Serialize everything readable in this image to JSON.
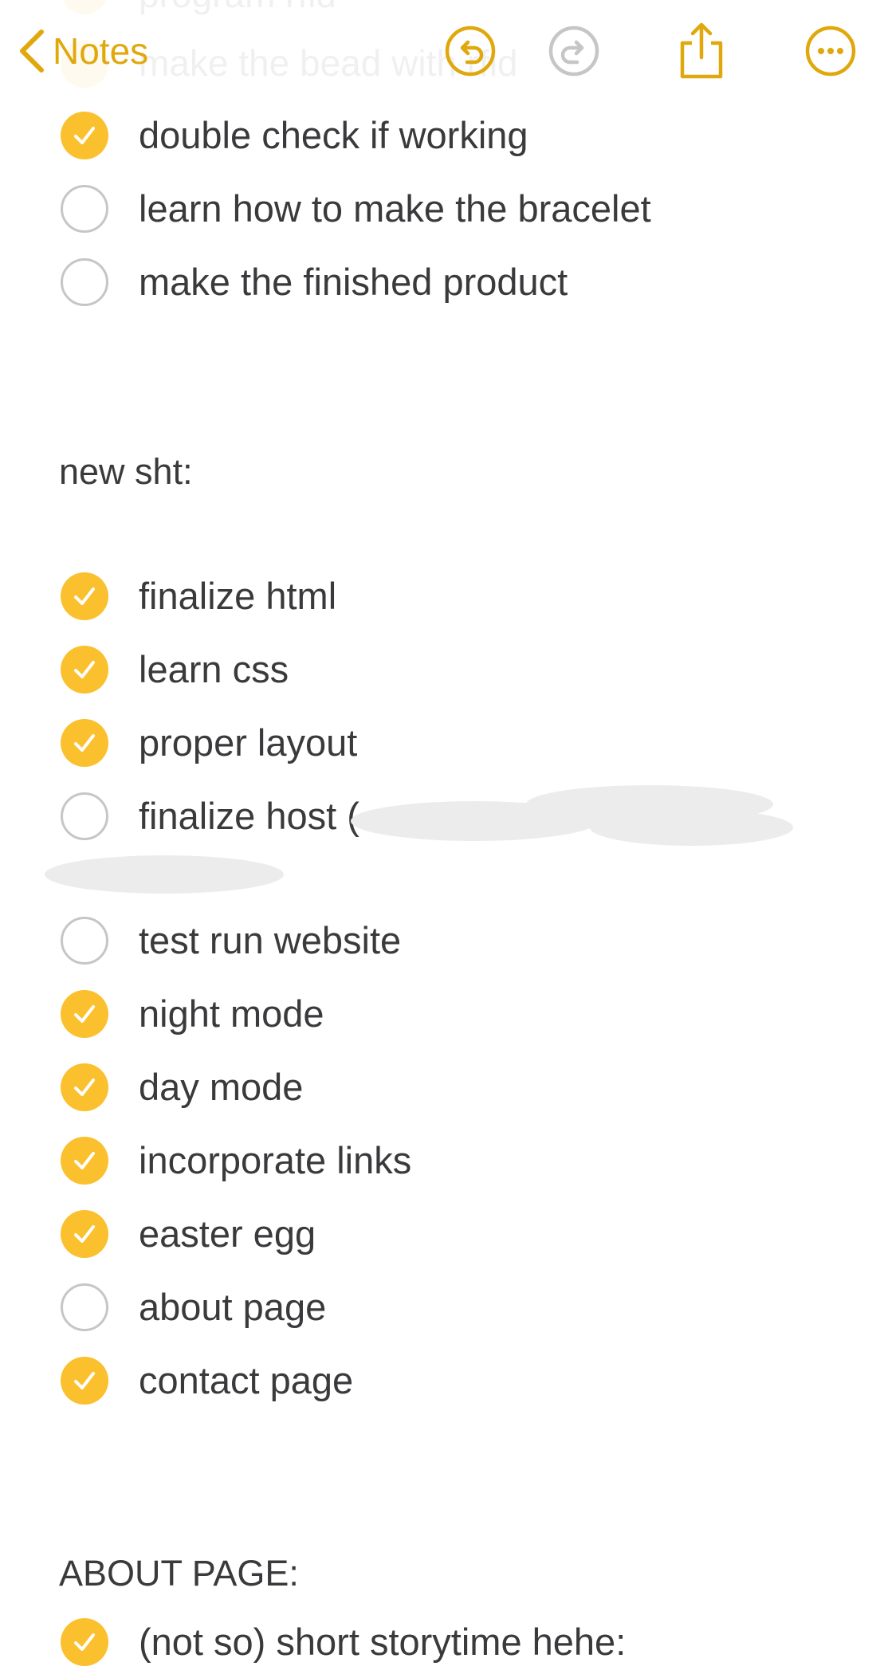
{
  "nav": {
    "back_label": "Notes",
    "icons": {
      "back": "chevron-left-icon",
      "undo": "undo-icon",
      "redo": "redo-icon",
      "share": "share-icon",
      "more": "more-icon"
    }
  },
  "colors": {
    "accent": "#e0a80d",
    "check_fill": "#fbc02d",
    "text": "#3a3a3c",
    "unchecked_border": "#c6c6c8"
  },
  "partial_top": {
    "line1": "program rfid",
    "line2": "make the bead with rfid"
  },
  "list1": [
    {
      "text": "double check if working",
      "checked": true
    },
    {
      "text": "learn how to make the bracelet",
      "checked": false
    },
    {
      "text": "make the finished product",
      "checked": false
    }
  ],
  "heading_new": "new sht:",
  "list2": [
    {
      "text": "finalize html",
      "checked": true
    },
    {
      "text": "learn css",
      "checked": true
    },
    {
      "text": "proper layout",
      "checked": true
    },
    {
      "text": "finalize host (",
      "checked": false
    },
    {
      "text": "test run website",
      "checked": false
    },
    {
      "text": "night mode",
      "checked": true
    },
    {
      "text": "day mode",
      "checked": true
    },
    {
      "text": "incorporate links",
      "checked": true
    },
    {
      "text": "easter egg",
      "checked": true
    },
    {
      "text": "about page",
      "checked": false
    },
    {
      "text": "contact page",
      "checked": true
    }
  ],
  "heading_about": "ABOUT PAGE:",
  "about_first_item": {
    "text": "(not so) short storytime hehe:",
    "checked": true
  }
}
